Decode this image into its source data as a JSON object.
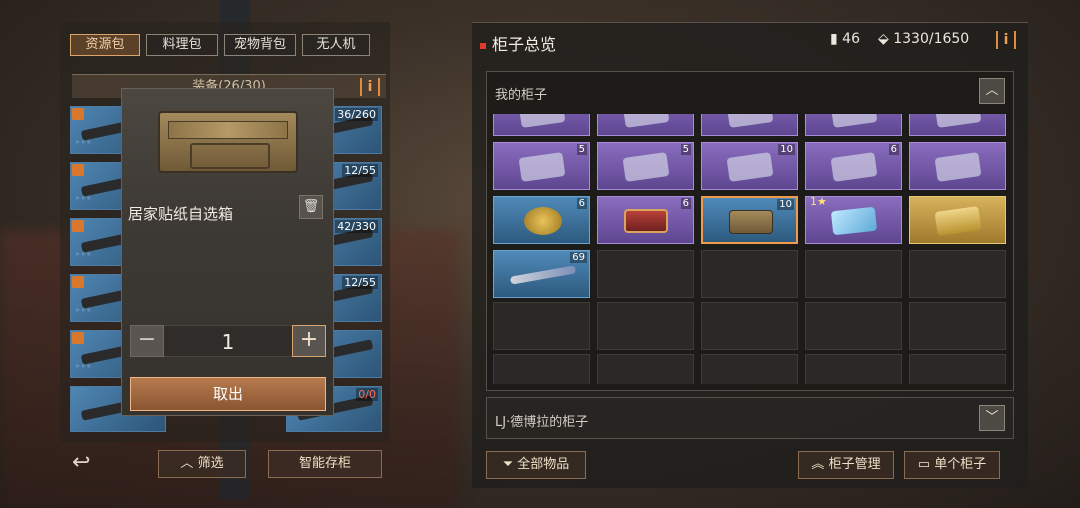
{
  "left": {
    "tabs": [
      {
        "label": "资源包",
        "active": true
      },
      {
        "label": "料理包",
        "active": false
      },
      {
        "label": "宠物背包",
        "active": false
      },
      {
        "label": "无人机",
        "active": false
      }
    ],
    "equip_label": "装备(26/30)",
    "weapon_counts": [
      "36/260",
      "12/55",
      "42/330",
      "12/55",
      "0/0"
    ],
    "dots": "◦◦◦",
    "filter_label": "筛选",
    "smart_store_label": "智能存柜"
  },
  "popup": {
    "item_name": "居家贴纸自选箱",
    "quantity": "1",
    "minus": "−",
    "plus": "+",
    "take_out_label": "取出"
  },
  "right": {
    "title": "柜子总览",
    "count_a": "46",
    "count_b": "1330/1650",
    "info": "i",
    "my_box_label": "我的柜子",
    "other_box_label": "LJ·德博拉的柜子",
    "row2_counts": [
      "5",
      "5",
      "10",
      "6",
      ""
    ],
    "row3_counts": [
      "6",
      "6",
      "10",
      "1",
      ""
    ],
    "row4_counts": [
      "69"
    ],
    "all_items_label": "全部物品",
    "box_manage_label": "柜子管理",
    "single_box_label": "单个柜子"
  },
  "icons": {
    "up": "︿",
    "down": "﹀",
    "back": "↩",
    "trash": "🗑",
    "filter": "⏷",
    "double_up": "︽",
    "monitor": "▭"
  },
  "colors": {
    "accent": "#e08b3e",
    "rarity_purple": "#8a6dbf",
    "rarity_blue": "#4f8ab9",
    "rarity_gold": "#d7b25c"
  }
}
